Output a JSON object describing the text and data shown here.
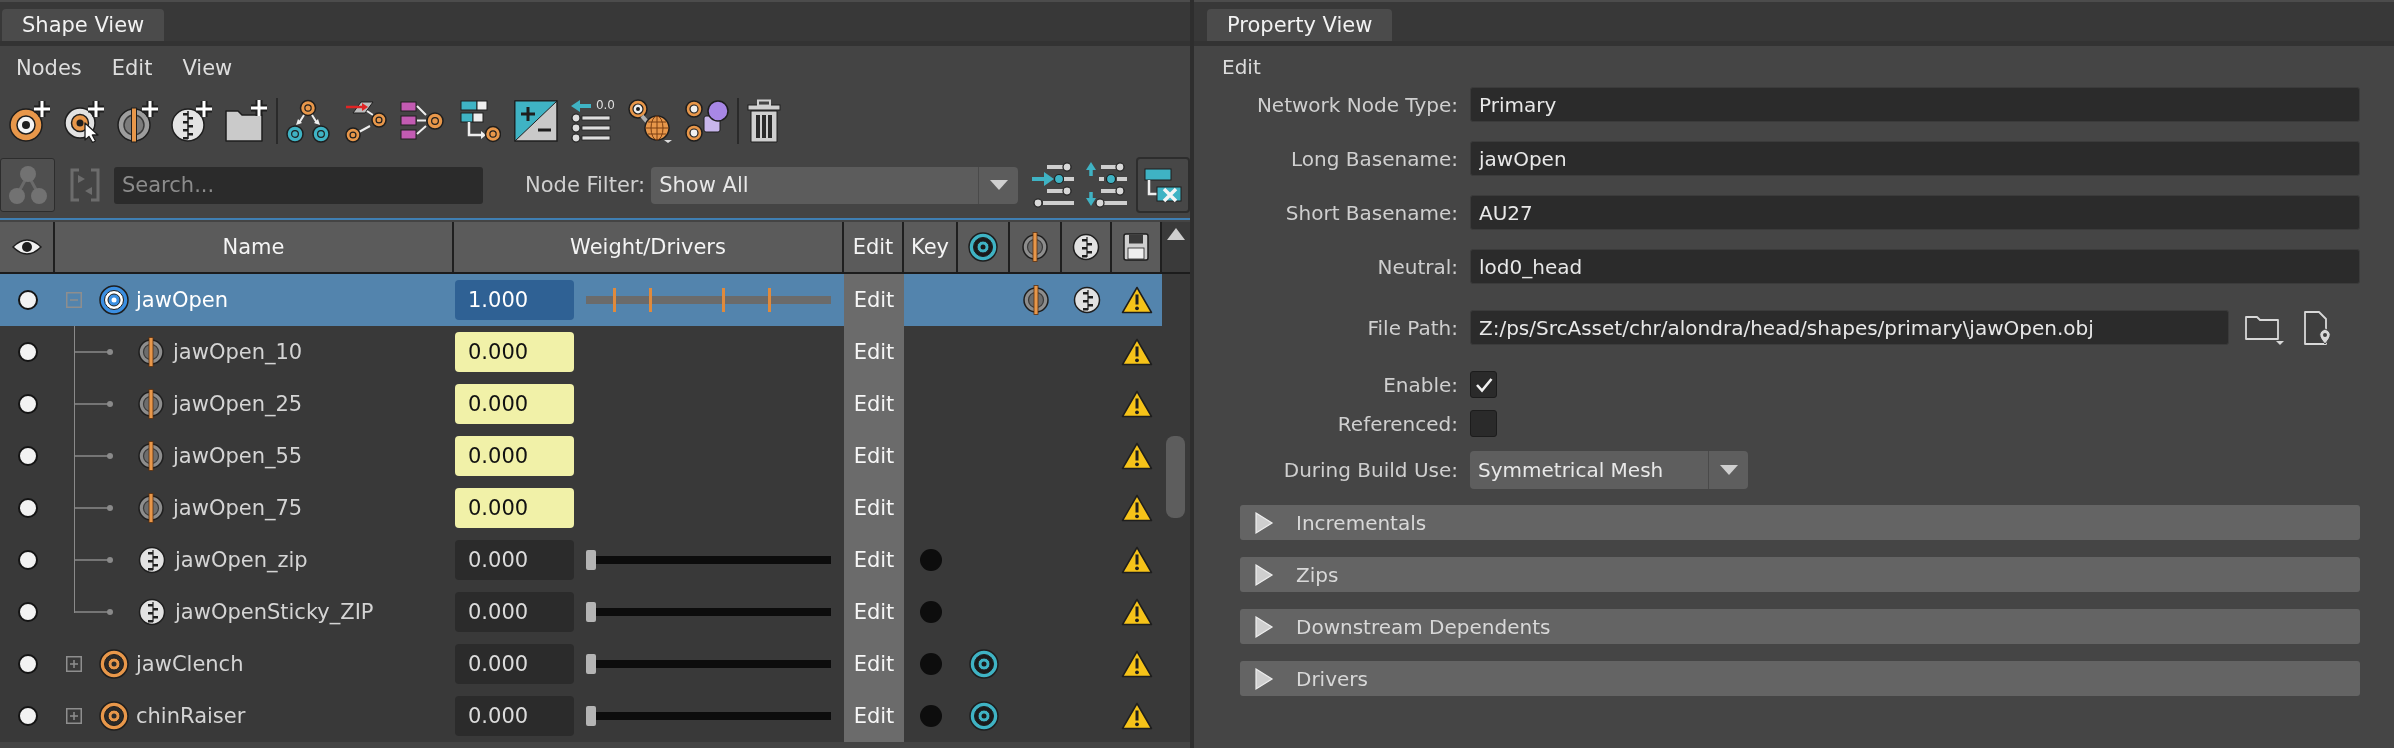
{
  "shape_view": {
    "tab": {
      "label": "Shape View",
      "selected": true
    },
    "menu": [
      "Nodes",
      "Edit",
      "View"
    ],
    "toolbar": {
      "reset_caption": "0.0"
    },
    "search": {
      "placeholder": "Search..."
    },
    "node_filter": {
      "label": "Node Filter:",
      "value": "Show All"
    },
    "table": {
      "columns": [
        "Name",
        "Weight/Drivers",
        "Edit",
        "Key"
      ],
      "rows": [
        {
          "kind": "primary",
          "name": "jawOpen",
          "selected": true,
          "expanded": true,
          "weight": "1.000",
          "edit_button": "Edit",
          "key": false,
          "primary_marker": false,
          "incremental_marker": true,
          "zip_marker": true,
          "warning": true,
          "children": [
            {
              "kind": "incremental",
              "name": "jawOpen_10",
              "selected": false,
              "weight": "0.000",
              "level": 0.11,
              "edit_button": "Edit",
              "key": false,
              "primary_marker": false,
              "incremental_marker": false,
              "zip_marker": false,
              "warning": true
            },
            {
              "kind": "incremental",
              "name": "jawOpen_25",
              "selected": false,
              "weight": "0.000",
              "level": 0.26,
              "edit_button": "Edit",
              "key": false,
              "primary_marker": false,
              "incremental_marker": false,
              "zip_marker": false,
              "warning": true
            },
            {
              "kind": "incremental",
              "name": "jawOpen_55",
              "selected": false,
              "weight": "0.000",
              "level": 0.56,
              "edit_button": "Edit",
              "key": false,
              "primary_marker": false,
              "incremental_marker": false,
              "zip_marker": false,
              "warning": true
            },
            {
              "kind": "incremental",
              "name": "jawOpen_75",
              "selected": false,
              "weight": "0.000",
              "level": 0.75,
              "edit_button": "Edit",
              "key": false,
              "primary_marker": false,
              "incremental_marker": false,
              "zip_marker": false,
              "warning": true
            },
            {
              "kind": "zip",
              "name": "jawOpen_zip",
              "selected": false,
              "weight": "0.000",
              "level": 0,
              "edit_button": "Edit",
              "key": true,
              "primary_marker": false,
              "incremental_marker": false,
              "zip_marker": false,
              "warning": true
            },
            {
              "kind": "zip",
              "name": "jawOpenSticky_ZIP",
              "selected": false,
              "weight": "0.000",
              "level": 0,
              "edit_button": "Edit",
              "key": true,
              "primary_marker": false,
              "incremental_marker": false,
              "zip_marker": false,
              "warning": true
            }
          ]
        },
        {
          "kind": "primary",
          "name": "jawClench",
          "selected": false,
          "expanded": false,
          "weight": "0.000",
          "level": 0,
          "edit_button": "Edit",
          "key": true,
          "primary_marker": true,
          "incremental_marker": false,
          "zip_marker": false,
          "warning": true
        },
        {
          "kind": "primary",
          "name": "chinRaiser",
          "selected": false,
          "expanded": false,
          "weight": "0.000",
          "level": 0,
          "edit_button": "Edit",
          "key": true,
          "primary_marker": true,
          "incremental_marker": false,
          "zip_marker": false,
          "warning": true
        }
      ]
    }
  },
  "property_view": {
    "tab": {
      "label": "Property View",
      "selected": true
    },
    "heading": "Edit",
    "fields": [
      {
        "kind": "text",
        "label": "Network Node Type:",
        "value": "Primary"
      },
      {
        "kind": "text",
        "label": "Long Basename:",
        "value": "jawOpen"
      },
      {
        "kind": "text",
        "label": "Short Basename:",
        "value": "AU27"
      },
      {
        "kind": "text",
        "label": "Neutral:",
        "value": "lod0_head"
      },
      {
        "kind": "path",
        "label": "File Path:",
        "value": "Z:/ps/SrcAsset/chr/alondra/head/shapes/primary\\jawOpen.obj"
      },
      {
        "kind": "checkbox",
        "label": "Enable:",
        "checked": true
      },
      {
        "kind": "checkbox",
        "label": "Referenced:",
        "checked": false
      },
      {
        "kind": "dropdown",
        "label": "During Build Use:",
        "value": "Symmetrical Mesh"
      }
    ],
    "sections": [
      {
        "label": "Incrementals",
        "expanded": false
      },
      {
        "label": "Zips",
        "expanded": false
      },
      {
        "label": "Downstream Dependents",
        "expanded": false
      },
      {
        "label": "Drivers",
        "expanded": false
      }
    ]
  }
}
